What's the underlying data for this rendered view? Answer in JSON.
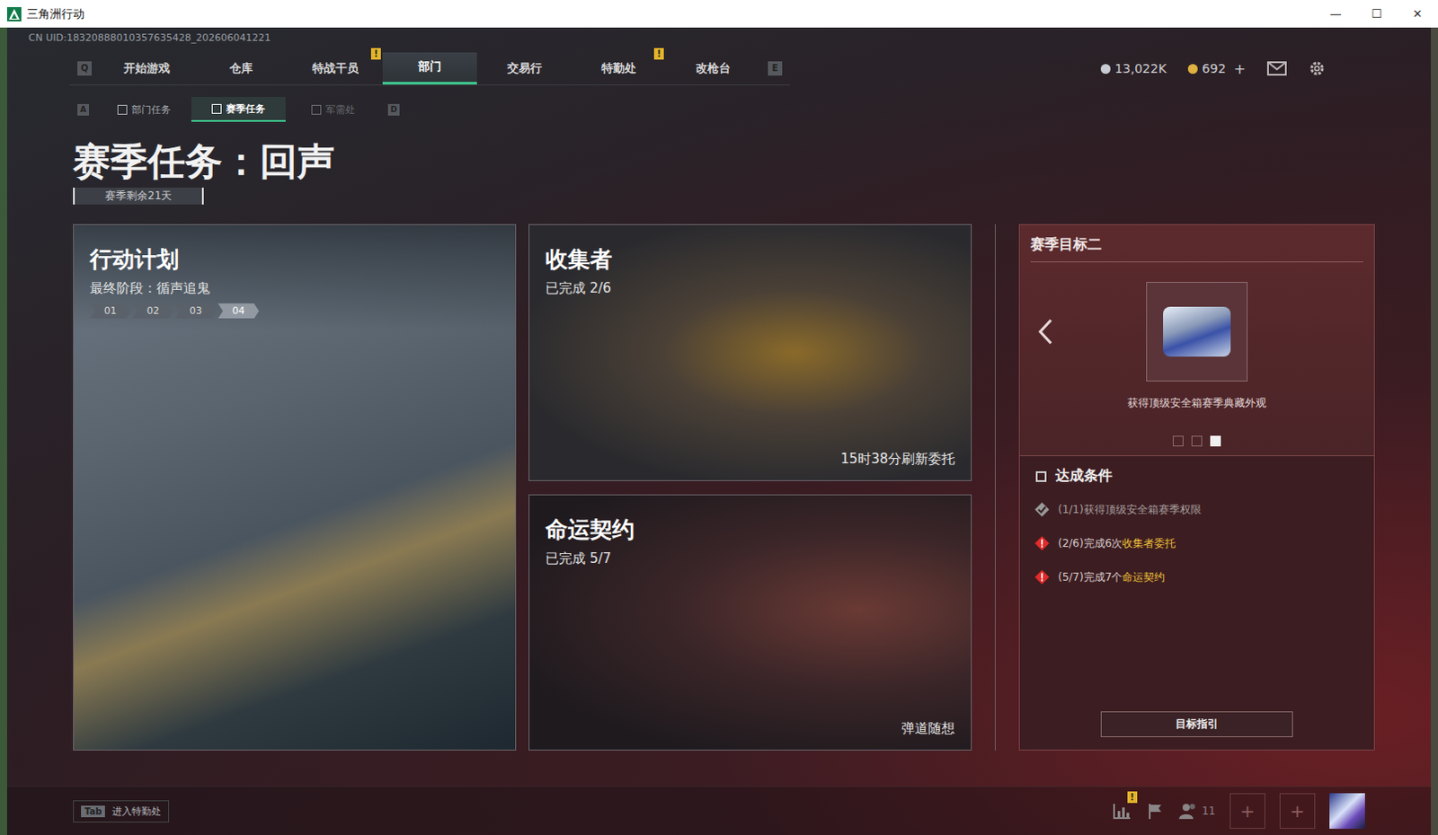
{
  "window": {
    "title": "三角洲行动",
    "controls": [
      "—",
      "☐",
      "✕"
    ]
  },
  "uid": "CN UID:18320888010357635428_202606041221",
  "nav": {
    "prev_key": "Q",
    "next_key": "E",
    "tabs": [
      {
        "label": "开始游戏",
        "selected": false,
        "badge": ""
      },
      {
        "label": "仓库",
        "selected": false,
        "badge": ""
      },
      {
        "label": "特战干员",
        "selected": false,
        "badge": "!"
      },
      {
        "label": "部门",
        "selected": true,
        "badge": ""
      },
      {
        "label": "交易行",
        "selected": false,
        "badge": ""
      },
      {
        "label": "特勤处",
        "selected": false,
        "badge": "!"
      },
      {
        "label": "改枪台",
        "selected": false,
        "badge": ""
      }
    ]
  },
  "currency": [
    {
      "value": "13,022K",
      "add": "",
      "color": "#c8ccd2"
    },
    {
      "value": "692",
      "add": "+",
      "color": "#e0b040"
    }
  ],
  "subnav": {
    "prev_key": "A",
    "next_key": "D",
    "tabs": [
      {
        "label": "部门任务",
        "selected": false,
        "disabled": false
      },
      {
        "label": "赛季任务",
        "selected": true,
        "disabled": false
      },
      {
        "label": "军需处",
        "selected": false,
        "disabled": true
      }
    ]
  },
  "page": {
    "title": "赛季任务：回声",
    "remaining": "赛季剩余21天"
  },
  "operation": {
    "title": "行动计划",
    "subtitle": "最终阶段：循声追鬼",
    "steps": [
      {
        "label": "01",
        "selected": false
      },
      {
        "label": "02",
        "selected": false
      },
      {
        "label": "03",
        "selected": false
      },
      {
        "label": "04",
        "selected": true
      }
    ]
  },
  "cards": [
    {
      "title": "收集者",
      "progress": "已完成 2/6",
      "footer": "15时38分刷新委托",
      "kind": "collector"
    },
    {
      "title": "命运契约",
      "progress": "已完成 5/7",
      "footer": "弹道随想",
      "kind": "contract"
    }
  ],
  "goal": {
    "title": "赛季目标二",
    "reward": "获得顶级安全箱赛季典藏外观",
    "pages": [
      {
        "selected": false
      },
      {
        "selected": false
      },
      {
        "selected": true
      }
    ],
    "conditions_title": "达成条件",
    "conditions": [
      {
        "progress": "(1/1)",
        "text": "获得顶级安全箱赛季权限",
        "highlight": "",
        "done": true
      },
      {
        "progress": "(2/6)",
        "text": "完成6次",
        "highlight": "收集者委托",
        "done": false
      },
      {
        "progress": "(5/7)",
        "text": "完成7个",
        "highlight": "命运契约",
        "done": false
      }
    ],
    "button": "目标指引"
  },
  "bottom": {
    "key": "Tab",
    "label": "进入特勤处",
    "stats_badge": "!",
    "friends": "11",
    "slots": [
      "+",
      "+"
    ]
  }
}
